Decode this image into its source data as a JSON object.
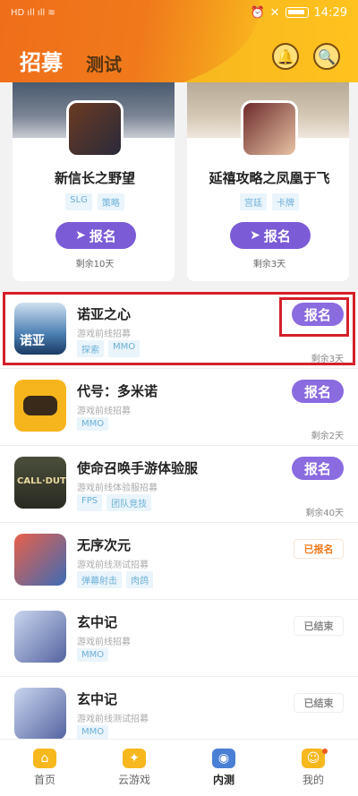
{
  "status_bar": {
    "left_text": "HD ıll ıll ≋",
    "time": "14:29"
  },
  "header": {
    "tab_active": "招募",
    "tab_inactive": "测试",
    "icons": [
      "bell-icon",
      "search-icon"
    ]
  },
  "cards": [
    {
      "title": "新信长之野望",
      "tags": [
        "SLG",
        "策略"
      ],
      "button": "报名",
      "remain": "剩余10天"
    },
    {
      "title": "延禧攻略之凤凰于飞",
      "tags": [
        "宫廷",
        "卡牌"
      ],
      "button": "报名",
      "remain": "剩余3天"
    }
  ],
  "list": [
    {
      "title": "诺亚之心",
      "icon_text": "诺亚",
      "subtitle": "游戏前线招募",
      "tags": [
        "探索",
        "MMO"
      ],
      "button": "报名",
      "remain": "剩余3天"
    },
    {
      "title": "代号：多米诺",
      "subtitle": "游戏前线招募",
      "tags": [
        "MMO"
      ],
      "button": "报名",
      "remain": "剩余2天"
    },
    {
      "title": "使命召唤手游体验服",
      "icon_text": "CALL·DUTY",
      "subtitle": "游戏前线体验服招募",
      "tags": [
        "FPS",
        "团队竞技"
      ],
      "button": "报名",
      "remain": "剩余40天"
    },
    {
      "title": "无序次元",
      "subtitle": "游戏前线测试招募",
      "tags": [
        "弹幕射击",
        "肉鸽"
      ],
      "button": "已报名"
    },
    {
      "title": "玄中记",
      "subtitle": "游戏前线招募",
      "tags": [
        "MMO"
      ],
      "button": "已结束"
    },
    {
      "title": "玄中记",
      "subtitle": "游戏前线测试招募",
      "tags": [
        "MMO"
      ],
      "button": "已结束"
    }
  ],
  "bottom_nav": [
    {
      "label": "首页",
      "icon": "home-icon"
    },
    {
      "label": "云游戏",
      "icon": "gamepad-icon"
    },
    {
      "label": "内测",
      "icon": "eye-icon"
    },
    {
      "label": "我的",
      "icon": "profile-icon"
    }
  ]
}
